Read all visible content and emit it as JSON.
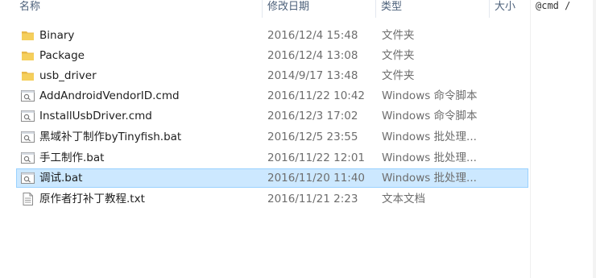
{
  "header": {
    "name": "名称",
    "date_modified": "修改日期",
    "type": "类型",
    "size": "大小"
  },
  "files": [
    {
      "icon": "folder-icon",
      "name": "Binary",
      "date": "2016/12/4 15:48",
      "type": "文件夹"
    },
    {
      "icon": "folder-icon",
      "name": "Package",
      "date": "2016/12/4 13:08",
      "type": "文件夹"
    },
    {
      "icon": "folder-icon",
      "name": "usb_driver",
      "date": "2014/9/17 13:48",
      "type": "文件夹"
    },
    {
      "icon": "script-file-icon",
      "name": "AddAndroidVendorID.cmd",
      "date": "2016/11/22 10:42",
      "type": "Windows 命令脚本"
    },
    {
      "icon": "script-file-icon",
      "name": "InstallUsbDriver.cmd",
      "date": "2016/12/3 17:02",
      "type": "Windows 命令脚本"
    },
    {
      "icon": "script-file-icon",
      "name": "黑域补丁制作byTinyfish.bat",
      "date": "2016/12/5 23:55",
      "type": "Windows 批处理..."
    },
    {
      "icon": "script-file-icon",
      "name": "手工制作.bat",
      "date": "2016/11/22 12:01",
      "type": "Windows 批处理..."
    },
    {
      "icon": "script-file-icon",
      "name": "调试.bat",
      "date": "2016/11/20 11:40",
      "type": "Windows 批处理...",
      "selected": true
    },
    {
      "icon": "text-file-icon",
      "name": "原作者打补丁教程.txt",
      "date": "2016/11/21 2:23",
      "type": "文本文档"
    }
  ],
  "cmd_window": {
    "text": "@cmd /"
  },
  "colors": {
    "selection_bg": "#cce8ff",
    "selection_border": "#99d1ff",
    "folder": "#f0c550",
    "header_text": "#4c607a"
  }
}
